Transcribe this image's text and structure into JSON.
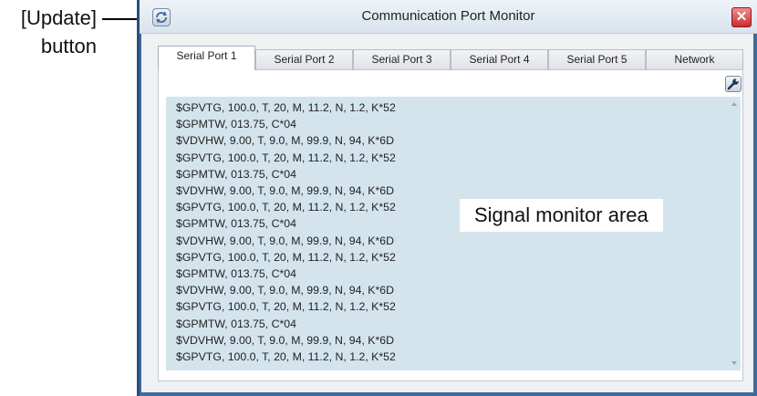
{
  "annotation": {
    "update_label_line1": "[Update]",
    "update_label_line2": "button"
  },
  "window": {
    "title": "Communication Port Monitor",
    "update_icon": "refresh-icon",
    "close_icon": "close-icon",
    "close_glyph": "✕"
  },
  "tabs": [
    {
      "label": "Serial Port 1",
      "active": true
    },
    {
      "label": "Serial Port 2",
      "active": false
    },
    {
      "label": "Serial Port 3",
      "active": false
    },
    {
      "label": "Serial Port 4",
      "active": false
    },
    {
      "label": "Serial Port 5",
      "active": false
    },
    {
      "label": "Network",
      "active": false
    }
  ],
  "toolbar": {
    "settings_icon": "wrench-icon"
  },
  "monitor": {
    "area_label": "Signal monitor area",
    "lines": [
      "$GPVTG, 100.0, T, 20, M, 11.2, N, 1.2, K*52",
      "$GPMTW, 013.75, C*04",
      "$VDVHW, 9.00, T, 9.0, M, 99.9, N, 94, K*6D",
      "$GPVTG, 100.0, T, 20, M, 11.2, N, 1.2, K*52",
      "$GPMTW, 013.75, C*04",
      "$VDVHW, 9.00, T, 9.0, M, 99.9, N, 94, K*6D",
      "$GPVTG, 100.0, T, 20, M, 11.2, N, 1.2, K*52",
      "$GPMTW, 013.75, C*04",
      "$VDVHW, 9.00, T, 9.0, M, 99.9, N, 94, K*6D",
      "$GPVTG, 100.0, T, 20, M, 11.2, N, 1.2, K*52",
      "$GPMTW, 013.75, C*04",
      "$VDVHW, 9.00, T, 9.0, M, 99.9, N, 94, K*6D",
      "$GPVTG, 100.0, T, 20, M, 11.2, N, 1.2, K*52",
      "$GPMTW, 013.75, C*04",
      "$VDVHW, 9.00, T, 9.0, M, 99.9, N, 94, K*6D",
      "$GPVTG, 100.0, T, 20, M, 11.2, N, 1.2, K*52"
    ]
  },
  "colors": {
    "window_frame": "#3e6b9f",
    "monitor_background": "#d3e4ed",
    "close_button": "#cc2b2b"
  }
}
